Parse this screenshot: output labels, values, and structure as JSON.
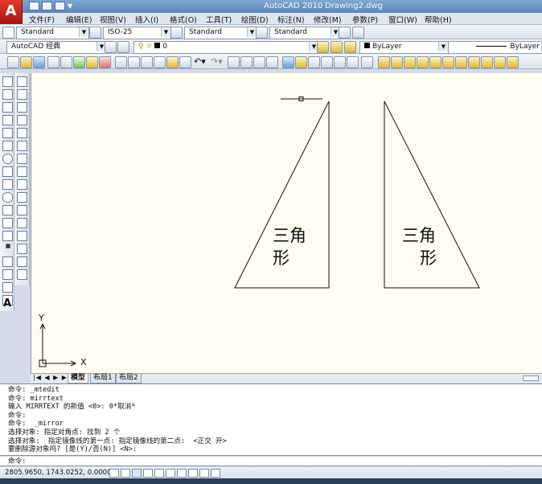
{
  "window": {
    "app_title": "AutoCAD 2010",
    "doc_title": "Drawing2.dwg"
  },
  "menu": [
    "文件(F)",
    "编辑(E)",
    "视图(V)",
    "插入(I)",
    "格式(O)",
    "工具(T)",
    "绘图(D)",
    "标注(N)",
    "修改(M)",
    "参数(P)",
    "窗口(W)",
    "帮助(H)"
  ],
  "styles_toolbar": {
    "text_style": "Standard",
    "dim_style": "ISO-25",
    "table_style": "Standard",
    "mleader_style": "Standard"
  },
  "workspace": "AutoCAD 经典",
  "layer": {
    "current": "0"
  },
  "properties": {
    "color": "ByLayer",
    "linetype": "ByLayer"
  },
  "drawing": {
    "left_triangle_text": [
      "三角",
      "形"
    ],
    "right_triangle_text": [
      "三角",
      "形"
    ]
  },
  "ucs": {
    "x_label": "X",
    "y_label": "Y"
  },
  "tabs": [
    "模型",
    "布局1",
    "布局2"
  ],
  "command_history": [
    "命令: _mtedit",
    "命令: mirrtext",
    "输入 MIRRTEXT 的新值 <0>: 0*取消*",
    "命令:",
    "命令:  _mirror",
    "选择对象: 指定对角点: 找到 2 个",
    "选择对象:  指定镜像线的第一点: 指定镜像线的第二点:  <正交 开>",
    "要删除源对象吗? [是(Y)/否(N)] <N>:"
  ],
  "command_prompt": "命令:",
  "status": {
    "coordinates": "2805.9650, 1743.0252, 0.0000"
  }
}
